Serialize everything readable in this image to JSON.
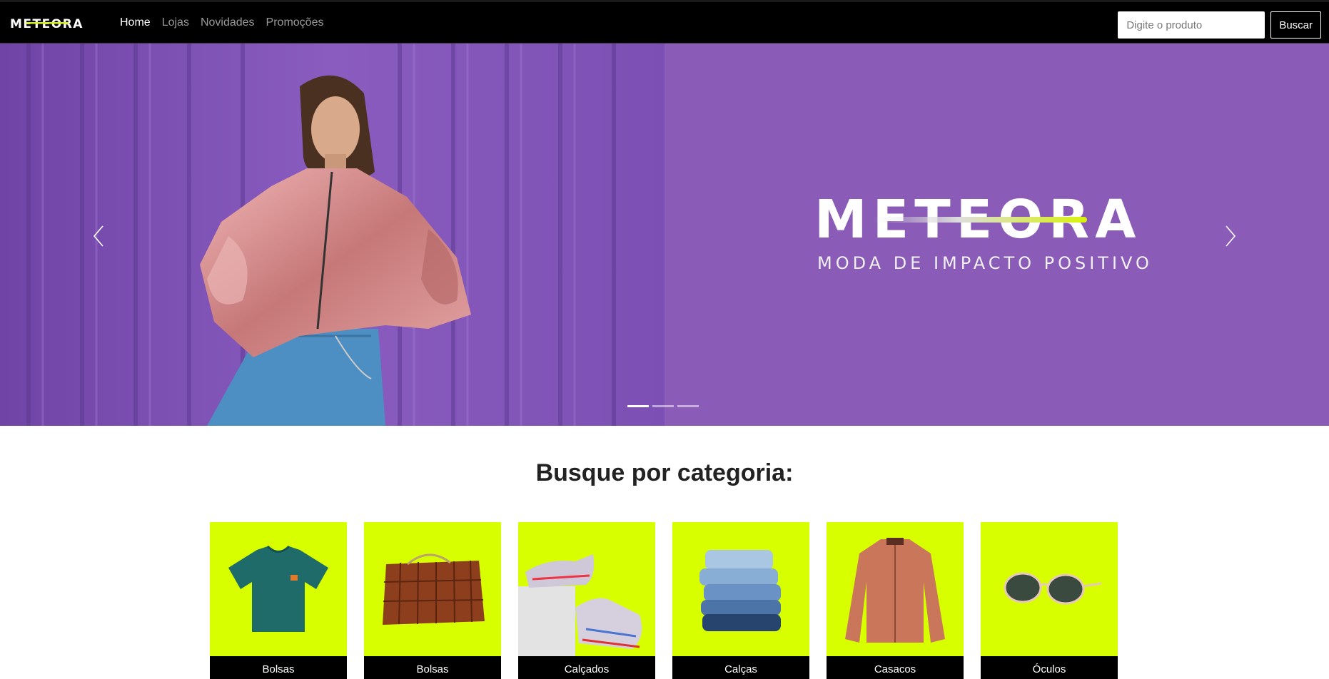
{
  "navbar": {
    "brand": "METEORA",
    "links": [
      {
        "label": "Home",
        "active": true
      },
      {
        "label": "Lojas",
        "active": false
      },
      {
        "label": "Novidades",
        "active": false
      },
      {
        "label": "Promoções",
        "active": false
      }
    ],
    "search": {
      "placeholder": "Digite o produto",
      "value": "",
      "button_label": "Buscar"
    }
  },
  "hero": {
    "logo_title": "METEORA",
    "logo_subtitle": "MODA DE IMPACTO POSITIVO",
    "slides_count": 3,
    "active_slide": 1,
    "colors": {
      "background": "#8a5cb7",
      "accent": "#d7f20a",
      "jacket": "#d99a9a",
      "jeans": "#4b86b8"
    }
  },
  "categories": {
    "title": "Busque por categoria:",
    "items": [
      {
        "label": "Bolsas",
        "icon": "tshirt-icon"
      },
      {
        "label": "Bolsas",
        "icon": "handbag-icon"
      },
      {
        "label": "Calçados",
        "icon": "sneakers-icon"
      },
      {
        "label": "Calças",
        "icon": "jeans-icon"
      },
      {
        "label": "Casacos",
        "icon": "jacket-icon"
      },
      {
        "label": "Óculos",
        "icon": "sunglasses-icon"
      }
    ],
    "card_color": "#d8ff00"
  }
}
